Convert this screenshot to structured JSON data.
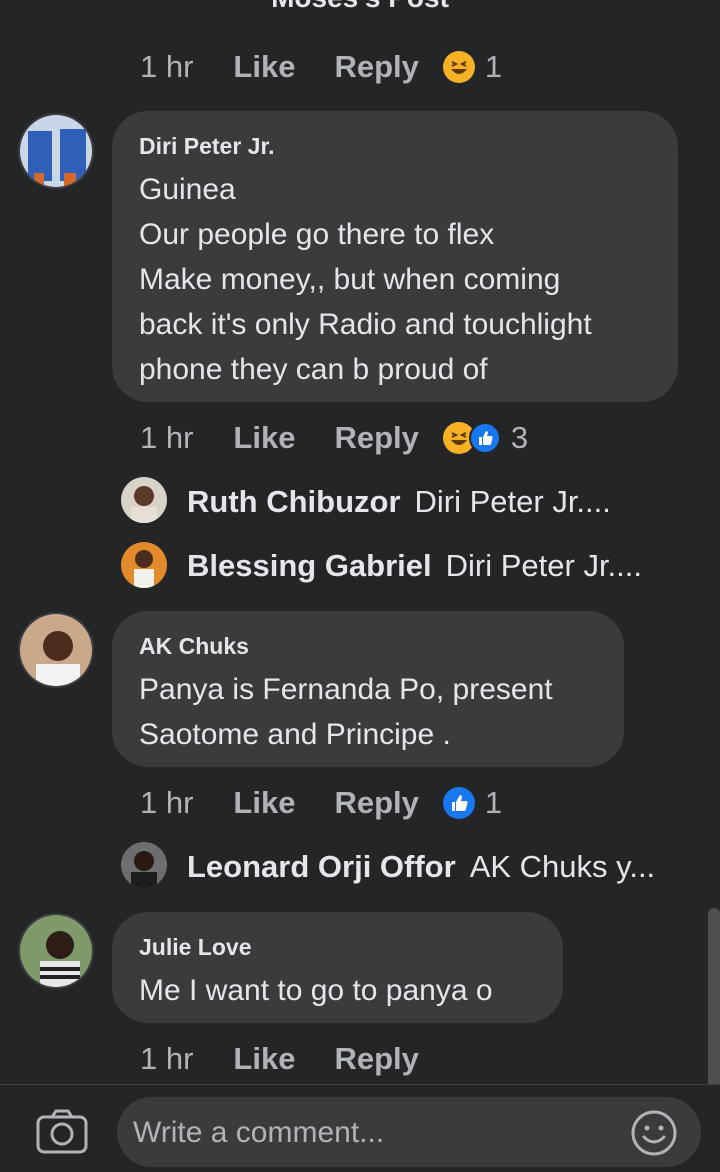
{
  "header": {
    "title": "Moses's Post"
  },
  "top_actions": {
    "time": "1 hr",
    "like": "Like",
    "reply": "Reply",
    "reaction_count": "1"
  },
  "comments": [
    {
      "author": "Diri Peter Jr.",
      "lines": [
        "Guinea",
        "Our people go there to flex",
        "Make money,, but when coming",
        "back it's only Radio and touchlight",
        "phone they can b proud of"
      ],
      "time": "1 hr",
      "like": "Like",
      "reply": "Reply",
      "reaction_count": "3",
      "replies": [
        {
          "name": "Ruth Chibuzor",
          "text": "Diri Peter Jr...."
        },
        {
          "name": "Blessing Gabriel",
          "text": "Diri Peter Jr...."
        }
      ]
    },
    {
      "author": "AK Chuks",
      "lines": [
        "Panya is Fernanda Po, present",
        "Saotome and Principe ."
      ],
      "time": "1 hr",
      "like": "Like",
      "reply": "Reply",
      "reaction_count": "1",
      "replies": [
        {
          "name": "Leonard Orji Offor",
          "text": "AK Chuks y..."
        }
      ]
    },
    {
      "author": "Julie Love",
      "lines": [
        "Me I want to go to panya o"
      ],
      "time": "1 hr",
      "like": "Like",
      "reply": "Reply"
    }
  ],
  "composer": {
    "placeholder": "Write a comment..."
  },
  "icons": {
    "back": "back-arrow-icon",
    "camera": "camera-icon",
    "emoji": "emoji-icon",
    "haha": "haha-reaction-icon",
    "like": "like-reaction-icon"
  },
  "colors": {
    "background": "#242526",
    "bubble": "#3a3b3c",
    "secondary_text": "#b0b3b8",
    "like_blue": "#1877f2",
    "haha_yellow": "#f7b125"
  }
}
